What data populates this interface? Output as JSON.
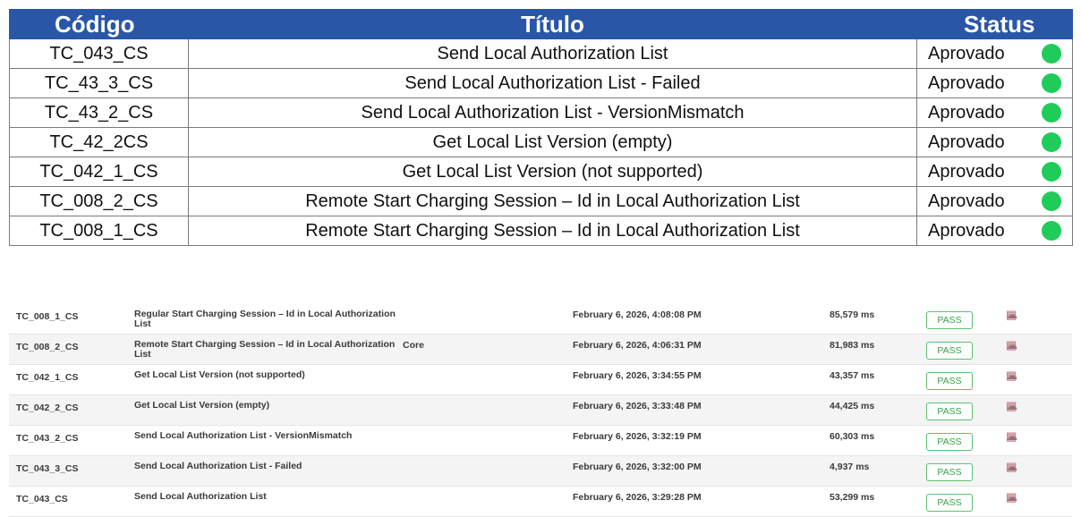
{
  "summary": {
    "headers": {
      "code": "Código",
      "title": "Título",
      "status": "Status"
    },
    "rows": [
      {
        "code": "TC_043_CS",
        "title": "Send Local Authorization List",
        "status": "Aprovado",
        "status_color": "#1fcc5a"
      },
      {
        "code": "TC_43_3_CS",
        "title": "Send Local Authorization List - Failed",
        "status": "Aprovado",
        "status_color": "#1fcc5a"
      },
      {
        "code": "TC_43_2_CS",
        "title": "Send Local Authorization List - VersionMismatch",
        "status": "Aprovado",
        "status_color": "#1fcc5a"
      },
      {
        "code": "TC_42_2CS",
        "title": "Get Local List Version (empty)",
        "status": "Aprovado",
        "status_color": "#1fcc5a"
      },
      {
        "code": "TC_042_1_CS",
        "title": "Get Local List Version (not supported)",
        "status": "Aprovado",
        "status_color": "#1fcc5a"
      },
      {
        "code": "TC_008_2_CS",
        "title": "Remote Start Charging Session – Id in Local Authorization List",
        "status": "Aprovado",
        "status_color": "#1fcc5a"
      },
      {
        "code": "TC_008_1_CS",
        "title": "Remote Start Charging Session – Id in Local Authorization List",
        "status": "Aprovado",
        "status_color": "#1fcc5a"
      }
    ]
  },
  "results": {
    "rows": [
      {
        "id": "TC_008_1_CS",
        "title": "Regular Start Charging Session – Id in Local Authorization List",
        "category": "",
        "date": "February 6, 2026, 4:08:08 PM",
        "duration": "85,579 ms",
        "result": "PASS"
      },
      {
        "id": "TC_008_2_CS",
        "title": "Remote Start Charging Session – Id in Local Authorization List",
        "category": "Core",
        "date": "February 6, 2026, 4:06:31 PM",
        "duration": "81,983 ms",
        "result": "PASS"
      },
      {
        "id": "TC_042_1_CS",
        "title": "Get Local List Version (not supported)",
        "category": "",
        "date": "February 6, 2026, 3:34:55 PM",
        "duration": "43,357 ms",
        "result": "PASS"
      },
      {
        "id": "TC_042_2_CS",
        "title": "Get Local List Version (empty)",
        "category": "",
        "date": "February 6, 2026, 3:33:48 PM",
        "duration": "44,425 ms",
        "result": "PASS"
      },
      {
        "id": "TC_043_2_CS",
        "title": "Send Local Authorization List - VersionMismatch",
        "category": "",
        "date": "February 6, 2026, 3:32:19 PM",
        "duration": "60,303 ms",
        "result": "PASS"
      },
      {
        "id": "TC_043_3_CS",
        "title": "Send Local Authorization List - Failed",
        "category": "",
        "date": "February 6, 2026, 3:32:00 PM",
        "duration": "4,937 ms",
        "result": "PASS"
      },
      {
        "id": "TC_043_CS",
        "title": "Send Local Authorization List",
        "category": "",
        "date": "February 6, 2026, 3:29:28 PM",
        "duration": "53,299 ms",
        "result": "PASS"
      }
    ],
    "icons": [
      "cloud-download-icon",
      "report-icon",
      "trash-icon"
    ]
  },
  "colors": {
    "header_bg": "#2a56a8",
    "status_ok": "#1fcc5a",
    "pass_border": "#5cc06e"
  }
}
